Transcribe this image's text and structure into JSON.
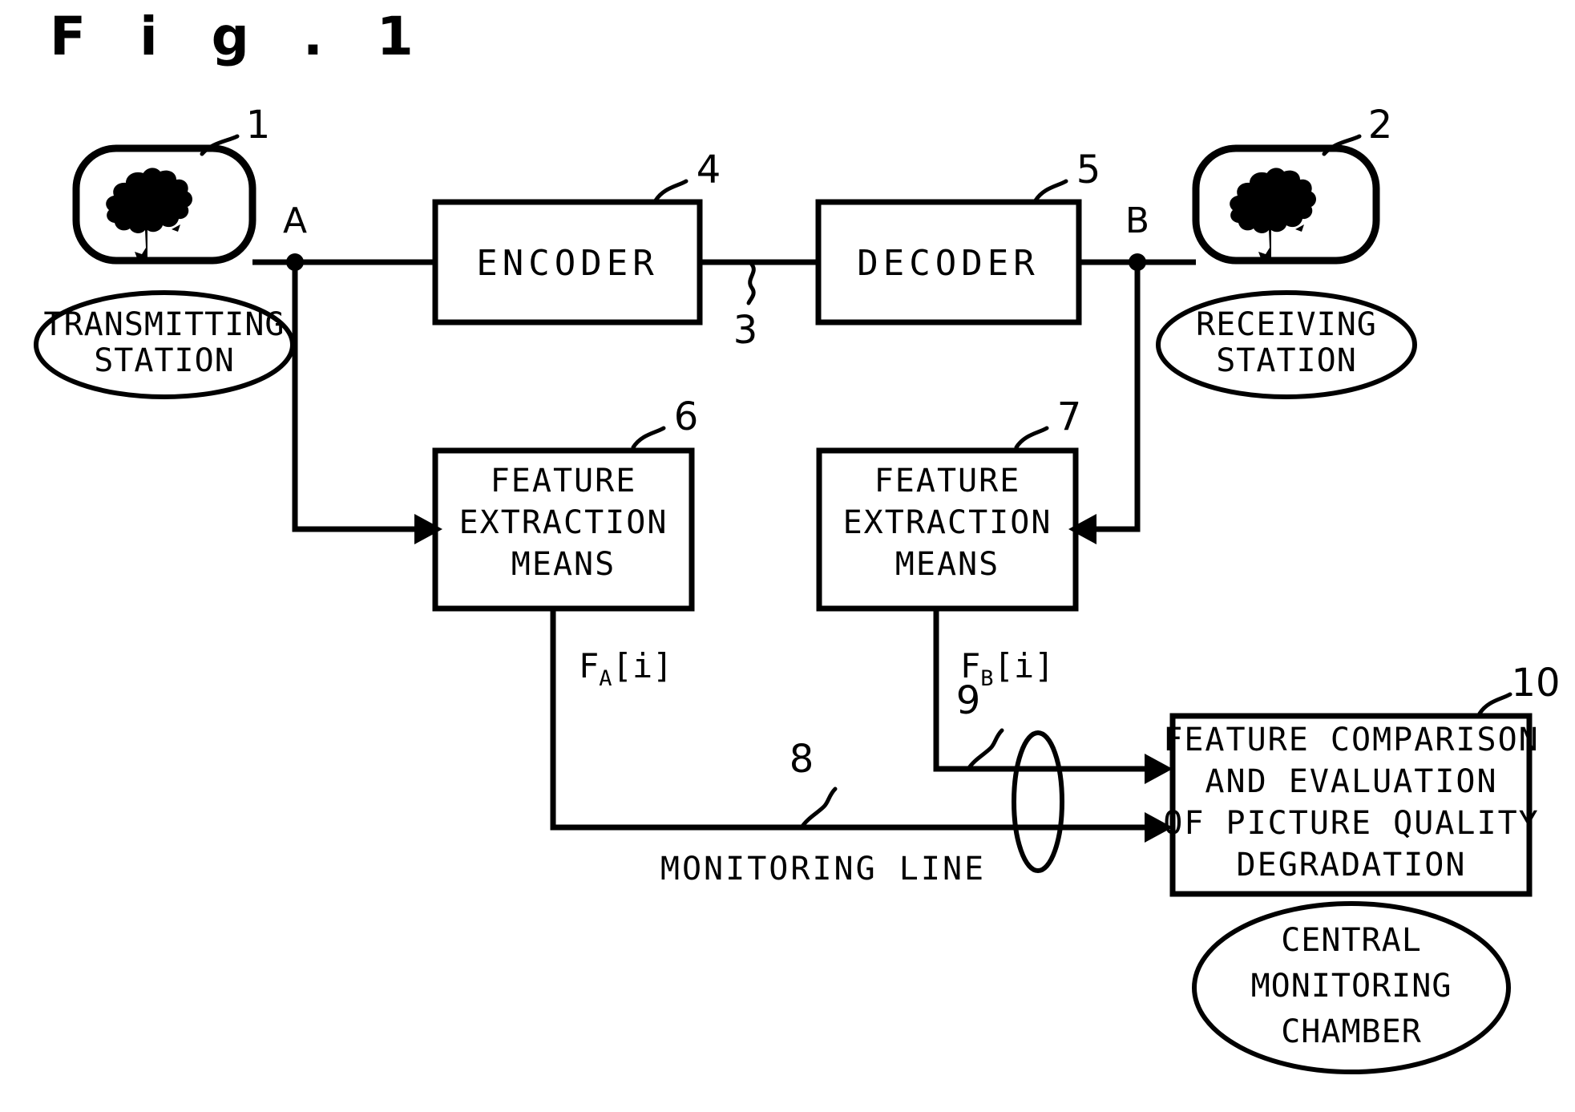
{
  "figure": {
    "title": "F i g .  1",
    "title_plain": "Fig. 1"
  },
  "nodes": {
    "transmitting_station": {
      "ref": "1",
      "caption_line1": "TRANSMITTING",
      "caption_line2": "STATION",
      "icon": "tree-icon"
    },
    "receiving_station": {
      "ref": "2",
      "caption_line1": "RECEIVING",
      "caption_line2": "STATION",
      "icon": "tree-icon"
    },
    "encoder": {
      "ref": "4",
      "label": "ENCODER"
    },
    "decoder": {
      "ref": "5",
      "label": "DECODER"
    },
    "transmission_path": {
      "ref": "3"
    },
    "feature_extraction_a": {
      "ref": "6",
      "line1": "FEATURE",
      "line2": "EXTRACTION",
      "line3": "MEANS"
    },
    "feature_extraction_b": {
      "ref": "7",
      "line1": "FEATURE",
      "line2": "EXTRACTION",
      "line3": "MEANS"
    },
    "central_monitoring": {
      "ref": "10",
      "line1": "FEATURE COMPARISON",
      "line2": "AND EVALUATION",
      "line3": "OF PICTURE QUALITY",
      "line4": "DEGRADATION",
      "caption_line1": "CENTRAL",
      "caption_line2": "MONITORING",
      "caption_line3": "CHAMBER"
    }
  },
  "points": {
    "a": "A",
    "b": "B"
  },
  "signals": {
    "fa": {
      "base": "F",
      "sub": "A",
      "index": "[i]"
    },
    "fb": {
      "base": "F",
      "sub": "B",
      "index": "[i]"
    }
  },
  "lines": {
    "monitoring_line_a": {
      "ref": "8",
      "label": "MONITORING LINE"
    },
    "monitoring_line_b": {
      "ref": "9"
    }
  },
  "colors": {
    "ink": "#000000",
    "paper": "#ffffff"
  }
}
